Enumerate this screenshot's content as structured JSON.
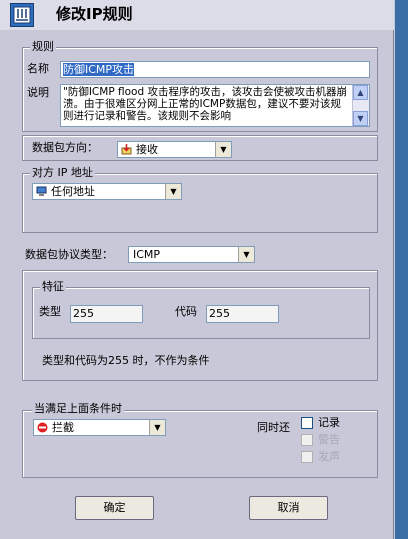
{
  "title": "修改IP规则",
  "rule_group": {
    "legend": "规则",
    "name_label": "名称",
    "name_value": "防御ICMP攻击",
    "desc_label": "说明",
    "desc_value": "\"防御ICMP flood 攻击程序的攻击，该攻击会使被攻击机器崩溃。由于很难区分网上正常的ICMP数据包，建议不要对该规则进行记录和警告。该规则不会影响"
  },
  "direction": {
    "label": "数据包方向：",
    "value": "接收"
  },
  "remote_group": {
    "legend": "对方 IP 地址",
    "value": "任何地址"
  },
  "protocol": {
    "label": "数据包协议类型：",
    "value": "ICMP"
  },
  "feature_group": {
    "legend": "特征",
    "type_label": "类型",
    "type_value": "255",
    "code_label": "代码",
    "code_value": "255",
    "note": "类型和代码为255 时，不作为条件"
  },
  "action_group": {
    "legend": "当满足上面条件时",
    "action_value": "拦截",
    "also_label": "同时还",
    "options": [
      {
        "label": "记录",
        "checked": false,
        "enabled": true
      },
      {
        "label": "警告",
        "checked": false,
        "enabled": false
      },
      {
        "label": "发声",
        "checked": false,
        "enabled": false
      }
    ]
  },
  "buttons": {
    "ok": "确定",
    "cancel": "取消"
  },
  "icons": {
    "app": "app-icon",
    "direction": "receive-icon",
    "address": "computer-icon",
    "action": "block-icon"
  }
}
